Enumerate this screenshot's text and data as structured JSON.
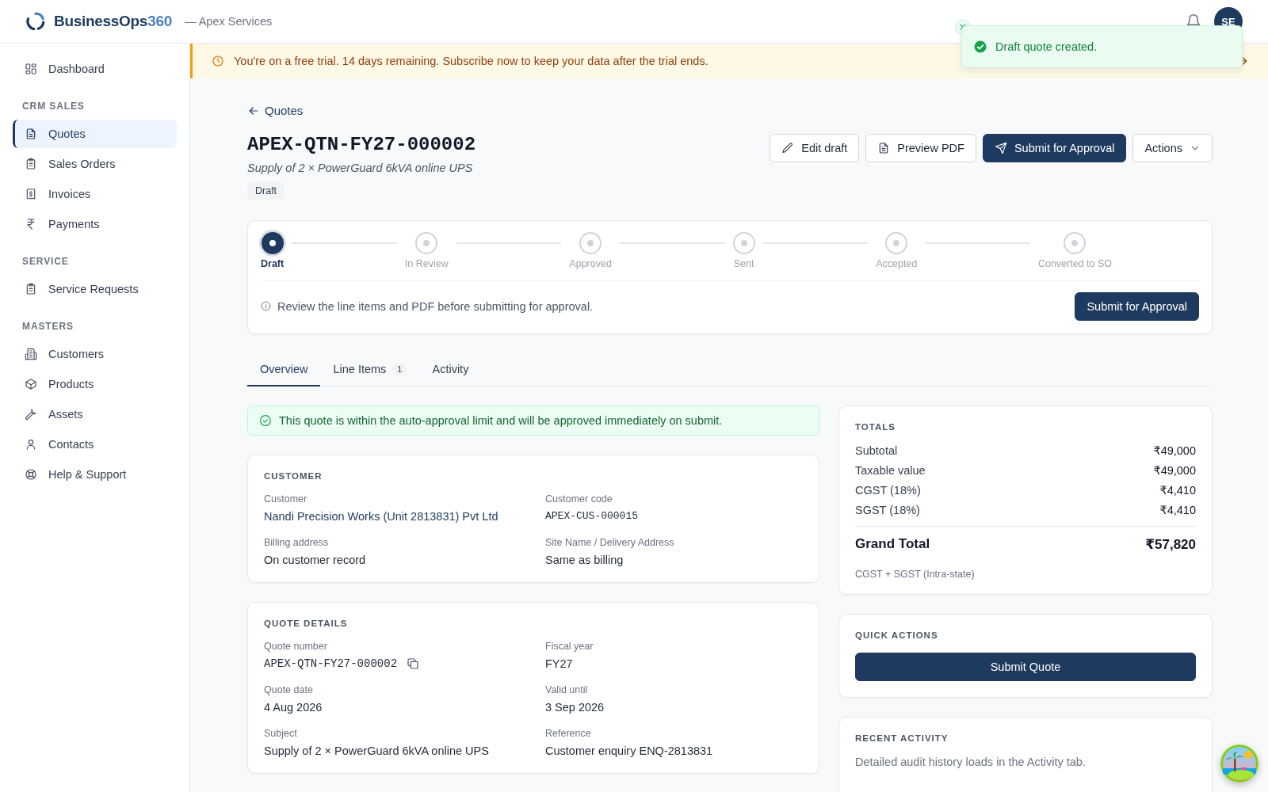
{
  "header": {
    "brand_name": "BusinessOps",
    "brand_suffix": "360",
    "workspace": "— Apex Services",
    "avatar": "SE"
  },
  "toast": {
    "kind": "success",
    "text": "Draft quote created."
  },
  "sidebar": {
    "sections": [
      {
        "items": [
          {
            "label": "Dashboard",
            "selected": false
          }
        ]
      },
      {
        "heading": "CRM SALES",
        "items": [
          {
            "label": "Quotes",
            "selected": true
          },
          {
            "label": "Sales Orders",
            "selected": false
          },
          {
            "label": "Invoices",
            "selected": false
          },
          {
            "label": "Payments",
            "selected": false
          }
        ]
      },
      {
        "heading": "SERVICE",
        "items": [
          {
            "label": "Service Requests",
            "selected": false
          }
        ]
      },
      {
        "heading": "MASTERS",
        "items": [
          {
            "label": "Customers",
            "selected": false
          },
          {
            "label": "Products",
            "selected": false
          },
          {
            "label": "Assets",
            "selected": false
          },
          {
            "label": "Contacts",
            "selected": false
          },
          {
            "label": "Help & Support",
            "selected": false
          }
        ]
      }
    ]
  },
  "banner": {
    "text": "You're on a free trial. 14 days remaining. Subscribe now to keep your data after the trial ends."
  },
  "back_link": "Quotes",
  "quote": {
    "number": "APEX-QTN-FY27-000002",
    "subject": "Supply of 2 × PowerGuard 6kVA online UPS",
    "status": "Draft"
  },
  "actions": [
    {
      "label": "Edit draft",
      "kind": "outline"
    },
    {
      "label": "Preview PDF",
      "kind": "outline"
    },
    {
      "label": "Submit for Approval",
      "kind": "primary"
    },
    {
      "label": "Actions",
      "kind": "menu"
    }
  ],
  "stepper": {
    "steps": [
      {
        "label": "Draft",
        "current": true
      },
      {
        "label": "In Review",
        "current": false
      },
      {
        "label": "Approved",
        "current": false
      },
      {
        "label": "Sent",
        "current": false
      },
      {
        "label": "Accepted",
        "current": false
      },
      {
        "label": "Converted to SO",
        "current": false
      }
    ],
    "hint": "Review the line items and PDF before submitting for approval.",
    "button": "Submit for Approval"
  },
  "tabs": [
    {
      "label": "Overview",
      "selected": true
    },
    {
      "label": "Line Items",
      "count": "1",
      "selected": false
    },
    {
      "label": "Activity",
      "selected": false
    }
  ],
  "approval_alert": "This quote is within the auto-approval limit and will be approved immediately on submit.",
  "cards": [
    {
      "title": "CUSTOMER",
      "fields": [
        {
          "label": "Customer",
          "value": "Nandi Precision Works (Unit 2813831) Pvt Ltd",
          "kind": "link"
        },
        {
          "label": "Customer code",
          "value": "APEX-CUS-000015",
          "kind": "code"
        },
        {
          "label": "Billing address",
          "value": "On customer record",
          "kind": "text"
        },
        {
          "label": "Site Name / Delivery Address",
          "value": "Same as billing",
          "kind": "text"
        }
      ]
    },
    {
      "title": "QUOTE DETAILS",
      "fields": [
        {
          "label": "Quote number",
          "value": "APEX-QTN-FY27-000002",
          "kind": "copy"
        },
        {
          "label": "Fiscal year",
          "value": "FY27",
          "kind": "text"
        },
        {
          "label": "Quote date",
          "value": "4 Aug 2026",
          "kind": "text"
        },
        {
          "label": "Valid until",
          "value": "3 Sep 2026",
          "kind": "text"
        },
        {
          "label": "Subject",
          "value": "Supply of 2 × PowerGuard 6kVA online UPS",
          "kind": "text"
        },
        {
          "label": "Reference",
          "value": "Customer enquiry ENQ-2813831",
          "kind": "text"
        }
      ]
    }
  ],
  "totals": {
    "title": "TOTALS",
    "rows": [
      {
        "label": "Subtotal",
        "value": "₹49,000"
      },
      {
        "label": "Taxable value",
        "value": "₹49,000"
      },
      {
        "label": "CGST (18%)",
        "value": "₹4,410"
      },
      {
        "label": "SGST (18%)",
        "value": "₹4,410"
      }
    ],
    "grand_total": {
      "label": "Grand Total",
      "value": "₹57,820"
    },
    "note": "CGST + SGST (Intra-state)"
  },
  "quick_actions": {
    "title": "QUICK ACTIONS",
    "button": "Submit Quote"
  },
  "recent_activity": {
    "title": "RECENT ACTIVITY",
    "text": "Detailed audit history loads in the Activity tab."
  }
}
